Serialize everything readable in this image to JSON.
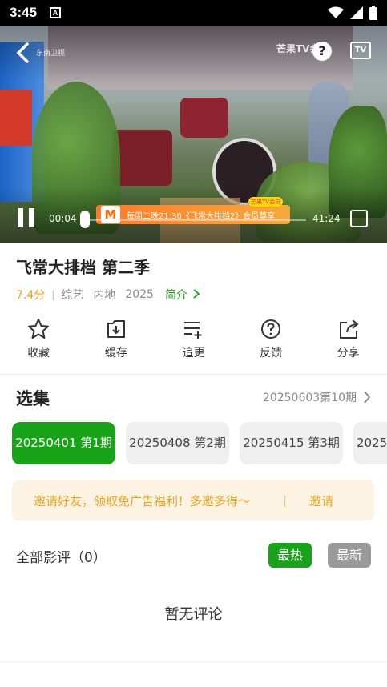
{
  "status_bar": {
    "time": "3:45",
    "app_icon_letter": "A"
  },
  "player": {
    "channel_logo": "东南卫视",
    "watermark": "芒果TV会员",
    "help_icon": "question-icon",
    "tv_label": "TV",
    "current_time": "00:04",
    "total_time": "41:24",
    "progress": 0.0,
    "promo": {
      "logo": "M",
      "text": "每周二晚21:30《飞常大排档2》会员尊享",
      "tag": "芒果TV会员"
    }
  },
  "show": {
    "title": "飞常大排档 第二季",
    "score": "7.4分",
    "genre": "综艺",
    "region": "内地",
    "year": "2025",
    "intro_label": "简介"
  },
  "actions": [
    {
      "label": "收藏",
      "icon": "star-icon"
    },
    {
      "label": "缓存",
      "icon": "download-icon"
    },
    {
      "label": "追更",
      "icon": "playlist-add-icon"
    },
    {
      "label": "反馈",
      "icon": "question-icon"
    },
    {
      "label": "分享",
      "icon": "share-icon"
    }
  ],
  "episodes_section": {
    "title": "选集",
    "latest": "20250603第10期",
    "episodes": [
      "20250401 第1期",
      "20250408 第2期",
      "20250415 第3期",
      "2025"
    ]
  },
  "invite": {
    "text": "邀请好友，领取免广告福利！多邀多得～",
    "separator": "|",
    "button": "邀请"
  },
  "reviews": {
    "title": "全部影评（0）",
    "sort_hot": "最热",
    "sort_new": "最新",
    "empty_text": "暂无评论"
  },
  "colors": {
    "accent_green": "#19a319",
    "score_orange": "#f2a01a",
    "invite_text": "#eaa522"
  }
}
